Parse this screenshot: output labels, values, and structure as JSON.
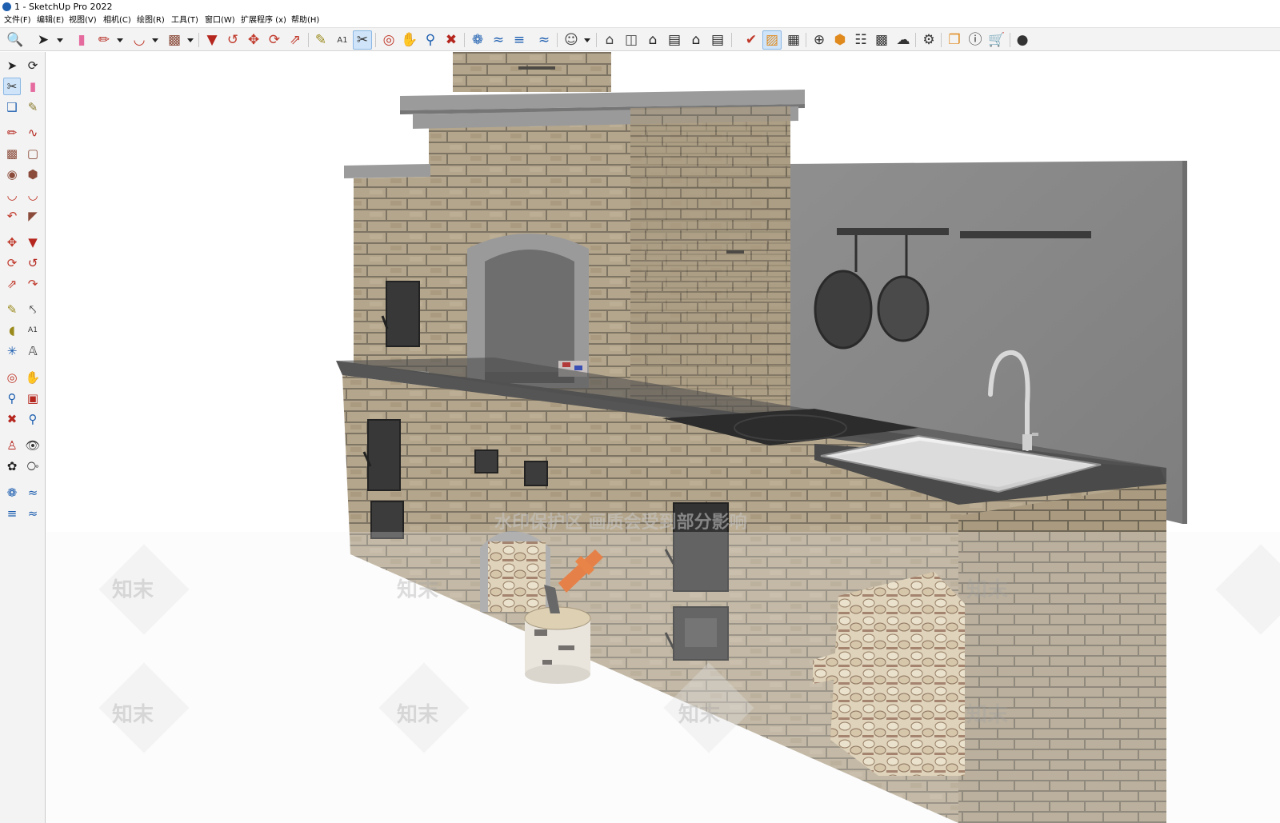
{
  "window": {
    "title": "1 - SketchUp Pro 2022"
  },
  "menu": {
    "items": [
      "文件(F)",
      "编辑(E)",
      "视图(V)",
      "相机(C)",
      "绘图(R)",
      "工具(T)",
      "窗口(W)",
      "扩展程序 (x)",
      "帮助(H)"
    ]
  },
  "toolbar": {
    "icons": [
      "zoom-icon",
      "select-icon",
      "eraser-icon",
      "pencil-icon",
      "arc-icon",
      "rectangle-icon",
      "push-pull-icon",
      "follow-me-icon",
      "move-icon",
      "rotate-icon",
      "scale-icon",
      "tape-measure-icon",
      "text-icon",
      "paint-bucket-icon",
      "orbit-icon",
      "pan-icon",
      "zoom-glass-icon",
      "zoom-extents-icon",
      "sandbox-from-contours-icon",
      "sandbox-from-scratch-icon",
      "smoove-icon",
      "stamp-icon",
      "user-icon",
      "iso-view-icon",
      "top-view-icon",
      "front-view-icon",
      "right-view-icon",
      "back-view-icon",
      "left-view-icon",
      "solid-tools-icon",
      "section-plane-icon",
      "section-display-icon",
      "add-location-icon",
      "model-info-icon",
      "3d-warehouse-icon",
      "extension-warehouse-icon",
      "upload-icon",
      "extension-manager-icon",
      "layout-icon",
      "info-icon",
      "shop-icon",
      "account-icon"
    ]
  },
  "watermarks": {
    "banner": "水印保护区  画质会受到部分影响",
    "tile": "知末"
  },
  "colors": {
    "brick": "#b3a58b",
    "brick_mortar": "#8c8170",
    "concrete": "#8d8d8d",
    "countertop": "#4a4a4a",
    "toolbar_bg": "#f3f3f3",
    "active_tool": "#cfe4f8"
  }
}
